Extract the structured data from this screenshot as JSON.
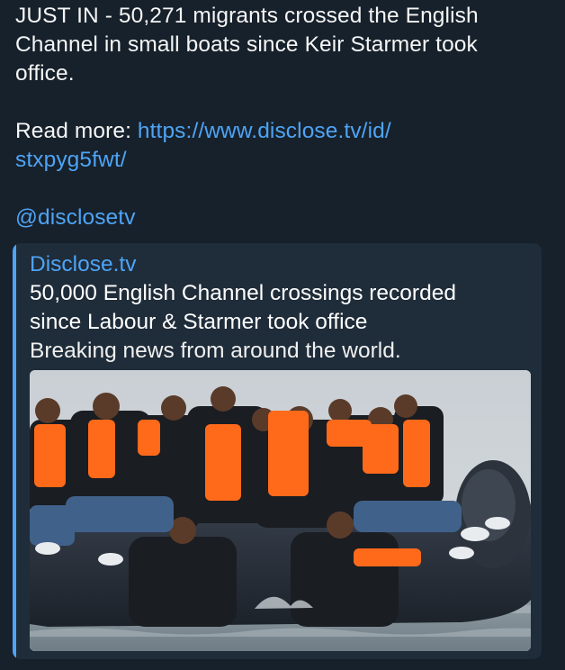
{
  "message": {
    "lines": [
      "JUST IN - 50,271 migrants crossed the English",
      "Channel in small boats since Keir Starmer took",
      "office."
    ],
    "read_more_label": "Read more: ",
    "link_line1": "https://www.disclose.tv/id/",
    "link_line2": "stxpyg5fwt/",
    "mention": "@disclosetv"
  },
  "preview": {
    "site_name": "Disclose.tv",
    "title_lines": [
      "50,000 English Channel crossings recorded",
      "since Labour & Starmer took office"
    ],
    "description": "Breaking news from around the world.",
    "image_icon": "photo-migrants-boat",
    "accent_color": "#4ea4f6",
    "background_color": "#1f2c39"
  },
  "theme": {
    "background": "#17212b",
    "link_color": "#4ea4f6",
    "text_color": "#f5f5f5"
  }
}
